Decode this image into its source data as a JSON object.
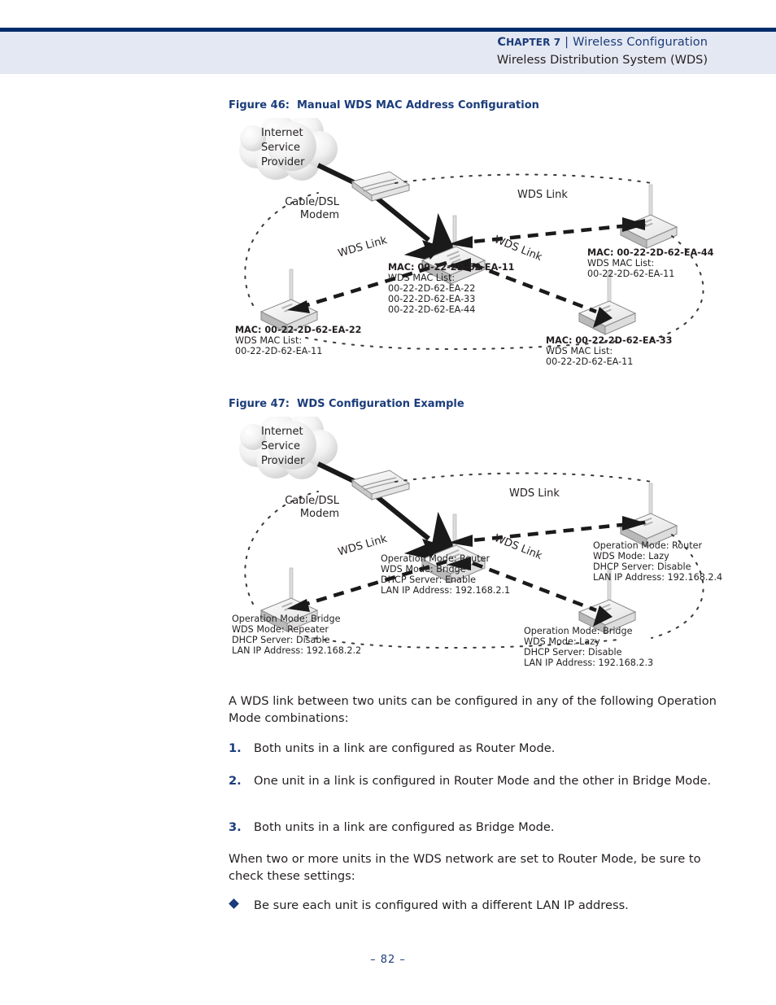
{
  "header": {
    "chapter_label": "CHAPTER 7",
    "chapter_label_lead": "C",
    "chapter_label_rest": "HAPTER 7",
    "separator": "|",
    "chapter_title": "Wireless Configuration",
    "section_title": "Wireless Distribution System (WDS)"
  },
  "figure46": {
    "caption": "Figure 46:  Manual WDS MAC Address Configuration",
    "cloud_label": "Internet\nService\nProvider",
    "modem_label": "Cable/DSL\nModem",
    "link_labels": {
      "top_right": "WDS Link",
      "left": "WDS Link",
      "right": "WDS Link"
    },
    "nodes": [
      {
        "id": "center",
        "mac": "MAC: 00-22-2D-62-EA-11",
        "list_title": "WDS MAC List:",
        "list": [
          "00-22-2D-62-EA-22",
          "00-22-2D-62-EA-33",
          "00-22-2D-62-EA-44"
        ]
      },
      {
        "id": "right-top",
        "mac": "MAC: 00-22-2D-62-EA-44",
        "list_title": "WDS MAC List:",
        "list": [
          "00-22-2D-62-EA-11"
        ]
      },
      {
        "id": "left-bottom",
        "mac": "MAC: 00-22-2D-62-EA-22",
        "list_title": "WDS MAC List:",
        "list": [
          "00-22-2D-62-EA-11"
        ]
      },
      {
        "id": "right-bottom",
        "mac": "MAC: 00-22-2D-62-EA-33",
        "list_title": "WDS MAC List:",
        "list": [
          "00-22-2D-62-EA-11"
        ]
      }
    ]
  },
  "figure47": {
    "caption": "Figure 47:  WDS Configuration Example",
    "cloud_label": "Internet\nService\nProvider",
    "modem_label": "Cable/DSL\nModem",
    "link_labels": {
      "top_right": "WDS Link",
      "left": "WDS Link",
      "right": "WDS Link"
    },
    "nodes": [
      {
        "id": "center",
        "lines": [
          "Operation Mode: Router",
          "WDS Mode: Bridge",
          "DHCP Server: Enable",
          "LAN IP Address: 192.168.2.1"
        ]
      },
      {
        "id": "right-top",
        "lines": [
          "Operation Mode: Router",
          "WDS Mode: Lazy",
          "DHCP Server: Disable",
          "LAN IP Address: 192.168.2.4"
        ]
      },
      {
        "id": "left-bottom",
        "lines": [
          "Operation Mode: Bridge",
          "WDS Mode: Repeater",
          "DHCP Server: Disable",
          "LAN IP Address: 192.168.2.2"
        ]
      },
      {
        "id": "right-bottom",
        "lines": [
          "Operation Mode: Bridge",
          "WDS Mode: Lazy",
          "DHCP Server: Disable",
          "LAN IP Address: 192.168.2.3"
        ]
      }
    ]
  },
  "body": {
    "intro": "A WDS link between two units can be configured in any of the following Operation Mode combinations:",
    "numbered": [
      {
        "num": "1.",
        "text": "Both units in a link are configured as Router Mode."
      },
      {
        "num": "2.",
        "text": "One unit in a link is configured in Router Mode and the other in Bridge Mode."
      },
      {
        "num": "3.",
        "text": "Both units in a link are configured as Bridge Mode."
      }
    ],
    "second_para": "When two or more units in the WDS network are set to Router Mode, be sure to check these settings:",
    "bullets": [
      "Be sure each unit is configured with a different LAN IP address."
    ]
  },
  "footer": {
    "page_number": "–  82  –"
  },
  "colors": {
    "accent": "#1b3c7b",
    "rule": "#002d6a",
    "band": "#e4e8f2",
    "text": "#231f20"
  }
}
